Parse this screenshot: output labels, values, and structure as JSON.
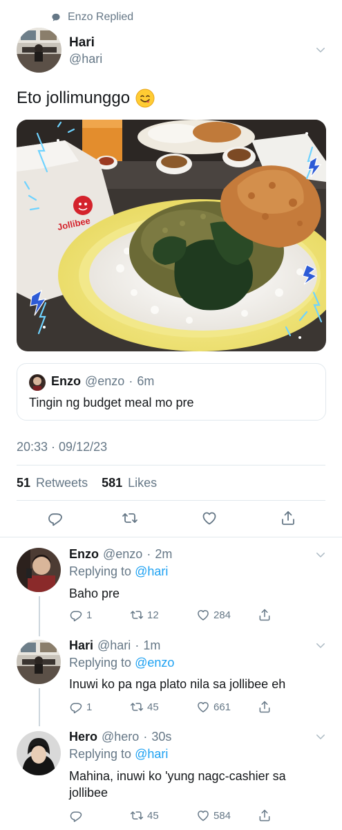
{
  "context": {
    "icon": "speech-bubble-icon",
    "label": "Enzo Replied"
  },
  "tweet": {
    "author": {
      "name": "Hari",
      "handle": "@hari"
    },
    "text": "Eto jollimunggo",
    "emoji": "😋",
    "photo_logo_text": "Jollibee",
    "quote": {
      "name": "Enzo",
      "handle": "@enzo",
      "time": "6m",
      "text": "Tingin ng budget meal mo pre"
    },
    "timestamp": "20:33 · 09/12/23",
    "retweets_count": "51",
    "retweets_label": "Retweets",
    "likes_count": "581",
    "likes_label": "Likes"
  },
  "replies": [
    {
      "name": "Enzo",
      "handle": "@enzo",
      "time": "2m",
      "replying_prefix": "Replying to",
      "replying_to": "@hari",
      "text": "Baho pre",
      "reply_count": "1",
      "retweet_count": "12",
      "like_count": "284"
    },
    {
      "name": "Hari",
      "handle": "@hari",
      "time": "1m",
      "replying_prefix": "Replying to",
      "replying_to": "@enzo",
      "text": "Inuwi ko pa nga plato nila sa jollibee eh",
      "reply_count": "1",
      "retweet_count": "45",
      "like_count": "661"
    },
    {
      "name": "Hero",
      "handle": "@hero",
      "time": "30s",
      "replying_prefix": "Replying to",
      "replying_to": "@hari",
      "text": "Mahina, inuwi ko 'yung nagc-cashier sa jollibee",
      "reply_count": "",
      "retweet_count": "45",
      "like_count": "584"
    }
  ],
  "colors": {
    "accent": "#1da1f2",
    "muted": "#657786",
    "divider": "#e1e8ed"
  }
}
